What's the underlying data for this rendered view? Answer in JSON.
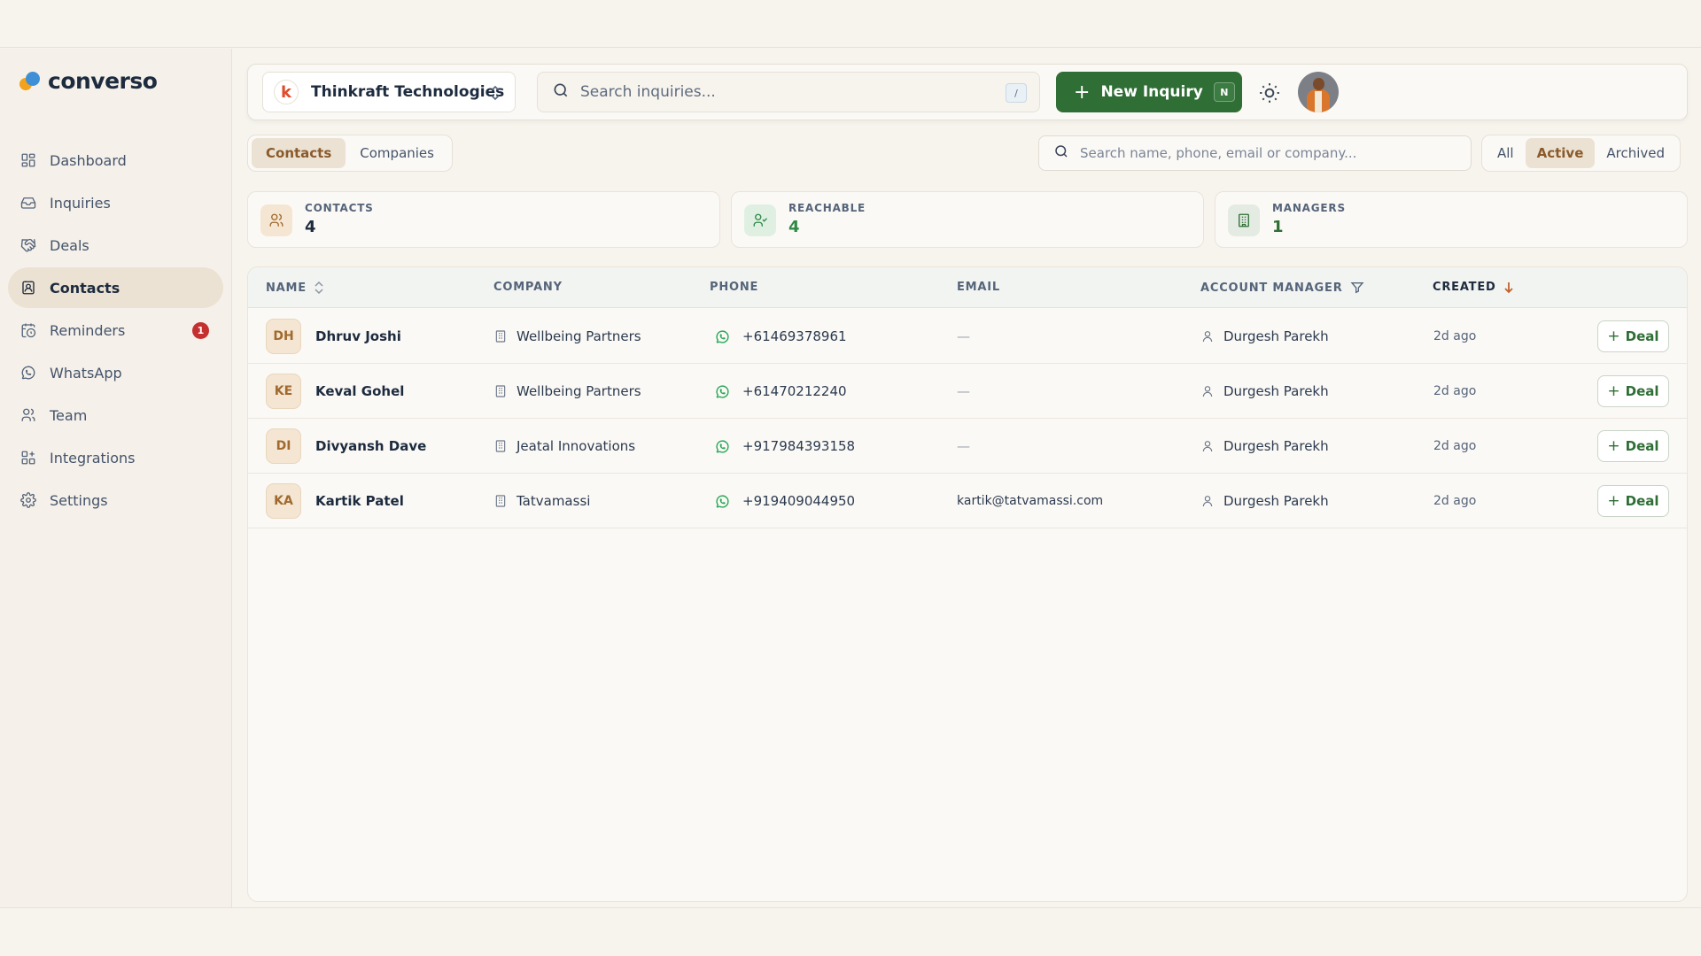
{
  "app": {
    "name": "converso"
  },
  "sidebar": {
    "items": [
      {
        "label": "Dashboard",
        "icon": "dashboard-icon"
      },
      {
        "label": "Inquiries",
        "icon": "inbox-icon"
      },
      {
        "label": "Deals",
        "icon": "handshake-icon"
      },
      {
        "label": "Contacts",
        "icon": "contacts-icon",
        "active": true
      },
      {
        "label": "Reminders",
        "icon": "calendar-clock-icon",
        "badge": "1"
      },
      {
        "label": "WhatsApp",
        "icon": "whatsapp-icon"
      },
      {
        "label": "Team",
        "icon": "team-icon"
      },
      {
        "label": "Integrations",
        "icon": "integrations-icon"
      },
      {
        "label": "Settings",
        "icon": "gear-icon"
      }
    ]
  },
  "header": {
    "org_initial": "k",
    "org_name": "Thinkraft Technologies",
    "search_placeholder": "Search inquiries...",
    "search_shortcut": "/",
    "new_inquiry_label": "New Inquiry",
    "new_inquiry_shortcut": "N"
  },
  "tabs": {
    "contacts": "Contacts",
    "companies": "Companies"
  },
  "list_search_placeholder": "Search name, phone, email or company...",
  "filters": {
    "all": "All",
    "active": "Active",
    "archived": "Archived"
  },
  "stats": [
    {
      "label": "CONTACTS",
      "value": "4",
      "color": "#1d2b3f"
    },
    {
      "label": "REACHABLE",
      "value": "4",
      "color": "#2f8a47"
    },
    {
      "label": "MANAGERS",
      "value": "1",
      "color": "#2f6e35"
    }
  ],
  "table": {
    "headers": {
      "name": "NAME",
      "company": "COMPANY",
      "phone": "PHONE",
      "email": "EMAIL",
      "account_manager": "ACCOUNT MANAGER",
      "created": "CREATED"
    },
    "deal_label": "Deal",
    "rows": [
      {
        "initials": "DH",
        "name": "Dhruv Joshi",
        "company": "Wellbeing Partners",
        "phone": "+61469378961",
        "email": "—",
        "manager": "Durgesh Parekh",
        "created": "2d ago"
      },
      {
        "initials": "KE",
        "name": "Keval Gohel",
        "company": "Wellbeing Partners",
        "phone": "+61470212240",
        "email": "—",
        "manager": "Durgesh Parekh",
        "created": "2d ago"
      },
      {
        "initials": "DI",
        "name": "Divyansh Dave",
        "company": "Jeatal Innovations",
        "phone": "+917984393158",
        "email": "—",
        "manager": "Durgesh Parekh",
        "created": "2d ago"
      },
      {
        "initials": "KA",
        "name": "Kartik Patel",
        "company": "Tatvamassi",
        "phone": "+919409044950",
        "email": "kartik@tatvamassi.com",
        "manager": "Durgesh Parekh",
        "created": "2d ago"
      }
    ]
  },
  "colors": {
    "accent": "#2f6e35",
    "active_tab": "#ece2d3",
    "badge": "#c62f2f"
  }
}
